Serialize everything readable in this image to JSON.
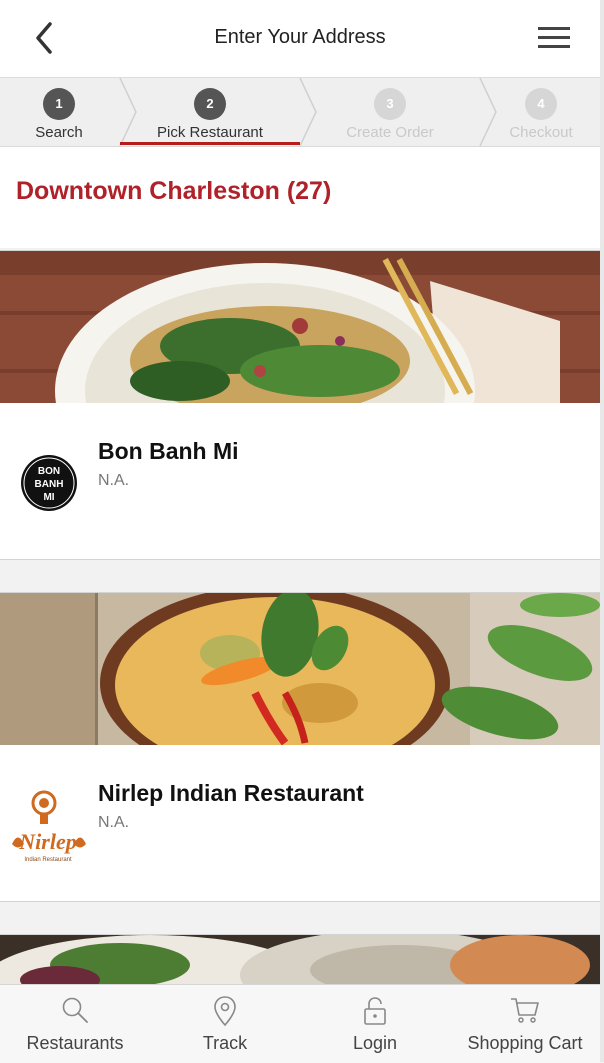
{
  "header": {
    "title": "Enter Your Address"
  },
  "steps": [
    {
      "num": "1",
      "label": "Search"
    },
    {
      "num": "2",
      "label": "Pick Restaurant"
    },
    {
      "num": "3",
      "label": "Create Order"
    },
    {
      "num": "4",
      "label": "Checkout"
    }
  ],
  "active_step": 2,
  "location": {
    "title": "Downtown Charleston (27)"
  },
  "restaurants": [
    {
      "name": "Bon Banh Mi",
      "subtitle": "N.A.",
      "logo_text": [
        "BON",
        "BANH",
        "MI"
      ]
    },
    {
      "name": "Nirlep Indian Restaurant",
      "subtitle": "N.A.",
      "logo_text": [
        "Nirlep",
        "Indian Restaurant"
      ]
    }
  ],
  "bottom_nav": [
    {
      "label": "Restaurants",
      "icon": "search-icon"
    },
    {
      "label": "Track",
      "icon": "location-pin-icon"
    },
    {
      "label": "Login",
      "icon": "lock-icon"
    },
    {
      "label": "Shopping Cart",
      "icon": "cart-icon"
    }
  ],
  "colors": {
    "accent": "#b0222a",
    "step_active": "#555555",
    "step_inactive": "#d6d6d6"
  }
}
